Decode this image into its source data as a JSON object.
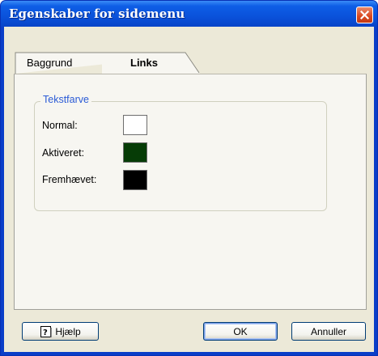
{
  "window": {
    "title": "Egenskaber for sidemenu"
  },
  "tabs": [
    {
      "label": "Baggrund",
      "active": false
    },
    {
      "label": "Links",
      "active": true
    }
  ],
  "group": {
    "title": "Tekstfarve"
  },
  "fields": [
    {
      "label": "Normal:",
      "color": "#ffffff"
    },
    {
      "label": "Aktiveret:",
      "color": "#063c06"
    },
    {
      "label": "Fremhævet:",
      "color": "#000000"
    }
  ],
  "buttons": {
    "help": "Hjælp",
    "ok": "OK",
    "cancel": "Annuller"
  },
  "colors": {
    "titlebar": "#0a52db",
    "dialog_bg": "#ece9d8",
    "close_button": "#d9471f",
    "group_title": "#2a5ad6"
  },
  "icons": {
    "close": "close-icon",
    "help": "help-book-icon"
  }
}
